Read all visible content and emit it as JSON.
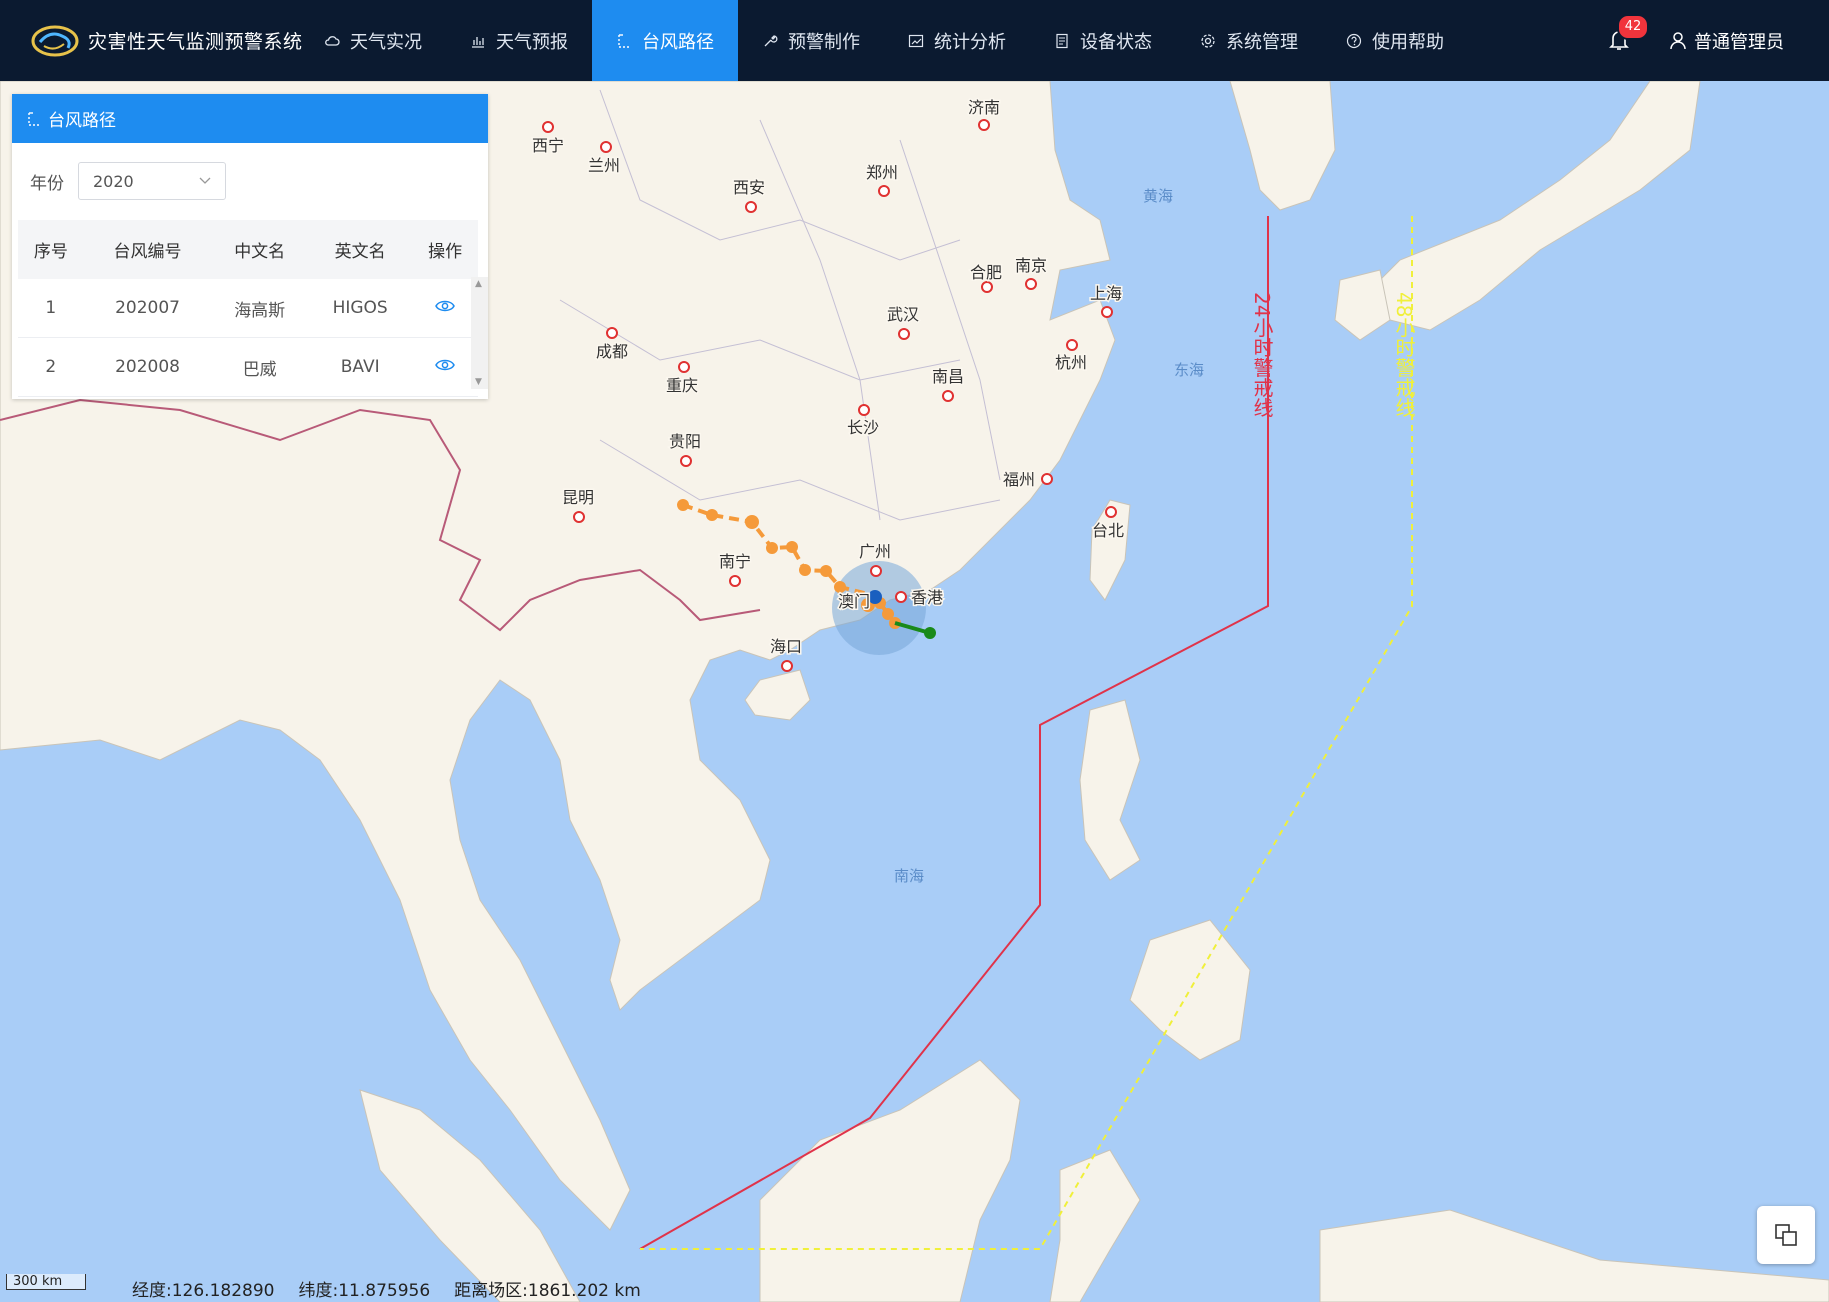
{
  "app": {
    "title": "灾害性天气监测预警系统"
  },
  "nav": {
    "items": [
      {
        "label": "天气实况",
        "icon": "cloud-icon"
      },
      {
        "label": "天气预报",
        "icon": "bar-chart-icon"
      },
      {
        "label": "台风路径",
        "icon": "route-icon",
        "active": true
      },
      {
        "label": "预警制作",
        "icon": "wrench-icon"
      },
      {
        "label": "统计分析",
        "icon": "line-chart-icon"
      },
      {
        "label": "设备状态",
        "icon": "document-icon"
      },
      {
        "label": "系统管理",
        "icon": "gear-icon"
      },
      {
        "label": "使用帮助",
        "icon": "help-circle-icon"
      }
    ],
    "notification_count": "42",
    "user": "普通管理员"
  },
  "panel": {
    "title": "台风路径",
    "year_label": "年份",
    "year_value": "2020",
    "columns": [
      "序号",
      "台风编号",
      "中文名",
      "英文名",
      "操作"
    ],
    "rows": [
      {
        "index": "1",
        "code": "202007",
        "cn": "海高斯",
        "en": "HIGOS"
      },
      {
        "index": "2",
        "code": "202008",
        "cn": "巴威",
        "en": "BAVI"
      }
    ]
  },
  "map": {
    "cities": [
      "西宁",
      "兰州",
      "济南",
      "西安",
      "郑州",
      "合肥",
      "南京",
      "上海",
      "成都",
      "武汉",
      "重庆",
      "南昌",
      "杭州",
      "长沙",
      "贵阳",
      "福州",
      "昆明",
      "台北",
      "广州",
      "南宁",
      "香港",
      "澳门",
      "海口"
    ],
    "seas": [
      "黄海",
      "东海",
      "南海"
    ],
    "warning_24h": "24小时警戒线",
    "warning_48h": "48小时警戒线",
    "colors": {
      "warning_24h": "#e0334a",
      "warning_48h": "#f0f03a",
      "track": "#f59a3a",
      "forecast": "#1a8a1a"
    }
  },
  "status": {
    "scale": "300 km",
    "lon": "经度:126.182890",
    "lat": "纬度:11.875956",
    "distance": "距离场区:1861.202 km"
  }
}
